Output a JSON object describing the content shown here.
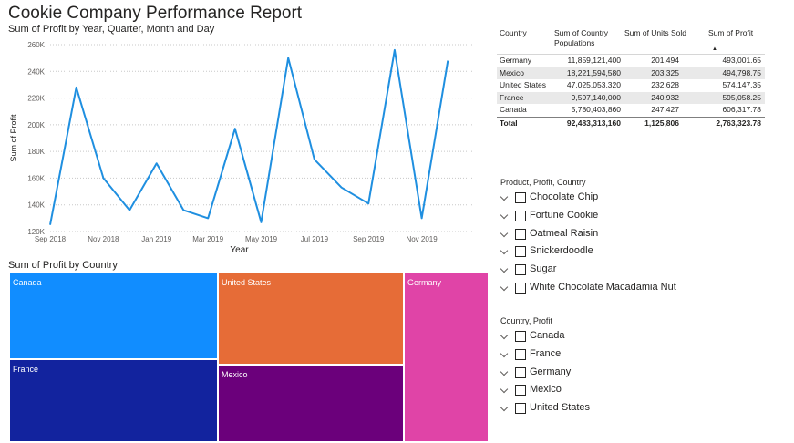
{
  "report": {
    "title": "Cookie Company Performance Report"
  },
  "line_chart": {
    "title": "Sum of Profit by Year, Quarter, Month and Day",
    "ylabel": "Sum of Profit",
    "xlabel": "Year",
    "line_color": "#1f8fe0"
  },
  "chart_data": {
    "type": "line",
    "title": "Sum of Profit by Year, Quarter, Month and Day",
    "xlabel": "Year",
    "ylabel": "Sum of Profit",
    "y_ticks": [
      "120K",
      "140K",
      "160K",
      "180K",
      "200K",
      "220K",
      "240K",
      "260K"
    ],
    "x_ticks": [
      "Sep 2018",
      "Nov 2018",
      "Jan 2019",
      "Mar 2019",
      "May 2019",
      "Jul 2019",
      "Sep 2019",
      "Nov 2019"
    ],
    "ylim": [
      120000,
      260000
    ],
    "xlim": [
      "2018-09-01",
      "2019-12-31"
    ],
    "grid": "horizontal dotted",
    "series": [
      {
        "x": [
          "2018-09-01",
          "2018-10-01",
          "2018-11-01",
          "2018-12-01",
          "2019-01-01",
          "2019-02-01",
          "2019-03-01",
          "2019-04-01",
          "2019-05-01",
          "2019-06-01",
          "2019-07-01",
          "2019-08-01",
          "2019-09-01",
          "2019-10-01",
          "2019-11-01",
          "2019-12-01"
        ],
        "values": [
          125000,
          228000,
          160000,
          136000,
          171000,
          136000,
          130000,
          197000,
          127000,
          250000,
          174000,
          153000,
          141000,
          256000,
          130000,
          248000
        ]
      }
    ]
  },
  "table": {
    "headers": [
      "Country",
      "Sum of Country Populations",
      "Sum of Units Sold",
      "Sum of Profit"
    ],
    "rows": [
      [
        "Germany",
        "11,859,121,400",
        "201,494",
        "493,001.65"
      ],
      [
        "Mexico",
        "18,221,594,580",
        "203,325",
        "494,798.75"
      ],
      [
        "United States",
        "47,025,053,320",
        "232,628",
        "574,147.35"
      ],
      [
        "France",
        "9,597,140,000",
        "240,932",
        "595,058.25"
      ],
      [
        "Canada",
        "5,780,403,860",
        "247,427",
        "606,317.78"
      ]
    ],
    "total": [
      "Total",
      "92,483,313,160",
      "1,125,806",
      "2,763,323.78"
    ],
    "sort_icon": "sort-ascending-icon"
  },
  "treemap": {
    "title": "Sum of Profit by Country",
    "cells": [
      {
        "label": "Canada",
        "color": "#118dff"
      },
      {
        "label": "France",
        "color": "#12239e"
      },
      {
        "label": "United States",
        "color": "#e66c37"
      },
      {
        "label": "Mexico",
        "color": "#6b007b"
      },
      {
        "label": "Germany",
        "color": "#e044a7"
      }
    ]
  },
  "slicer_product": {
    "title": "Product, Profit, Country",
    "items": [
      "Chocolate Chip",
      "Fortune Cookie",
      "Oatmeal Raisin",
      "Snickerdoodle",
      "Sugar",
      "White Chocolate Macadamia Nut"
    ]
  },
  "slicer_country": {
    "title": "Country, Profit",
    "items": [
      "Canada",
      "France",
      "Germany",
      "Mexico",
      "United States"
    ]
  }
}
